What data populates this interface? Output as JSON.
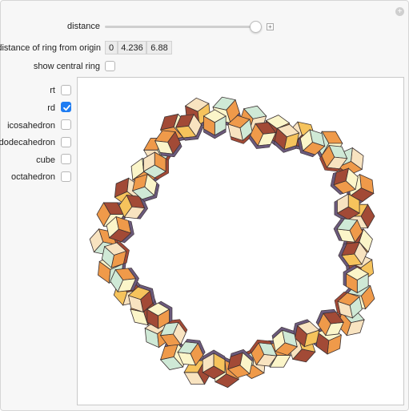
{
  "controls": {
    "distance_label": "distance",
    "ring_distance_label": "distance of ring from origin",
    "ring_distance_values": [
      "0",
      "4.236",
      "6.88"
    ],
    "show_central_ring_label": "show central ring",
    "options": [
      {
        "label": "rt",
        "checked": false
      },
      {
        "label": "rd",
        "checked": true
      },
      {
        "label": "icosahedron",
        "checked": false
      },
      {
        "label": "dodecahedron",
        "checked": false
      },
      {
        "label": "cube",
        "checked": false
      },
      {
        "label": "octahedron",
        "checked": false
      }
    ]
  },
  "slider": {
    "value_fraction": 0.97
  },
  "plot": {
    "description_icon": "rhombic-dodecahedron-ring",
    "rings": 2,
    "polyhedra_per_ring": 30,
    "colors": {
      "light": "#fbf5c9",
      "cream": "#f8e3c0",
      "orange": "#ef9a4a",
      "brown": "#a24a36",
      "purple": "#6b5a7c",
      "mint": "#cfe9d6",
      "gold": "#f6c35c"
    }
  }
}
